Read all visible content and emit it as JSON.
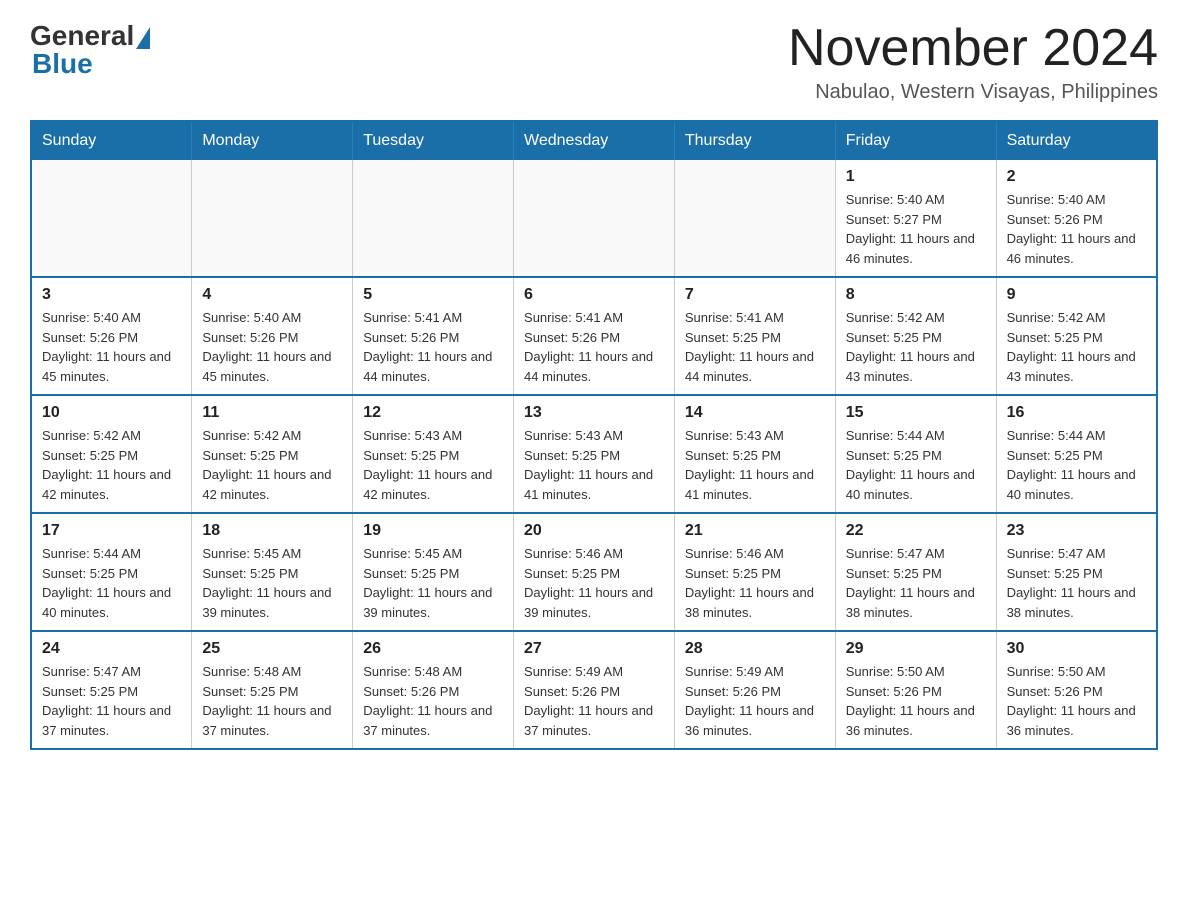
{
  "logo": {
    "general": "General",
    "blue": "Blue"
  },
  "title": "November 2024",
  "subtitle": "Nabulao, Western Visayas, Philippines",
  "headers": [
    "Sunday",
    "Monday",
    "Tuesday",
    "Wednesday",
    "Thursday",
    "Friday",
    "Saturday"
  ],
  "weeks": [
    [
      {
        "day": "",
        "info": ""
      },
      {
        "day": "",
        "info": ""
      },
      {
        "day": "",
        "info": ""
      },
      {
        "day": "",
        "info": ""
      },
      {
        "day": "",
        "info": ""
      },
      {
        "day": "1",
        "info": "Sunrise: 5:40 AM\nSunset: 5:27 PM\nDaylight: 11 hours and 46 minutes."
      },
      {
        "day": "2",
        "info": "Sunrise: 5:40 AM\nSunset: 5:26 PM\nDaylight: 11 hours and 46 minutes."
      }
    ],
    [
      {
        "day": "3",
        "info": "Sunrise: 5:40 AM\nSunset: 5:26 PM\nDaylight: 11 hours and 45 minutes."
      },
      {
        "day": "4",
        "info": "Sunrise: 5:40 AM\nSunset: 5:26 PM\nDaylight: 11 hours and 45 minutes."
      },
      {
        "day": "5",
        "info": "Sunrise: 5:41 AM\nSunset: 5:26 PM\nDaylight: 11 hours and 44 minutes."
      },
      {
        "day": "6",
        "info": "Sunrise: 5:41 AM\nSunset: 5:26 PM\nDaylight: 11 hours and 44 minutes."
      },
      {
        "day": "7",
        "info": "Sunrise: 5:41 AM\nSunset: 5:25 PM\nDaylight: 11 hours and 44 minutes."
      },
      {
        "day": "8",
        "info": "Sunrise: 5:42 AM\nSunset: 5:25 PM\nDaylight: 11 hours and 43 minutes."
      },
      {
        "day": "9",
        "info": "Sunrise: 5:42 AM\nSunset: 5:25 PM\nDaylight: 11 hours and 43 minutes."
      }
    ],
    [
      {
        "day": "10",
        "info": "Sunrise: 5:42 AM\nSunset: 5:25 PM\nDaylight: 11 hours and 42 minutes."
      },
      {
        "day": "11",
        "info": "Sunrise: 5:42 AM\nSunset: 5:25 PM\nDaylight: 11 hours and 42 minutes."
      },
      {
        "day": "12",
        "info": "Sunrise: 5:43 AM\nSunset: 5:25 PM\nDaylight: 11 hours and 42 minutes."
      },
      {
        "day": "13",
        "info": "Sunrise: 5:43 AM\nSunset: 5:25 PM\nDaylight: 11 hours and 41 minutes."
      },
      {
        "day": "14",
        "info": "Sunrise: 5:43 AM\nSunset: 5:25 PM\nDaylight: 11 hours and 41 minutes."
      },
      {
        "day": "15",
        "info": "Sunrise: 5:44 AM\nSunset: 5:25 PM\nDaylight: 11 hours and 40 minutes."
      },
      {
        "day": "16",
        "info": "Sunrise: 5:44 AM\nSunset: 5:25 PM\nDaylight: 11 hours and 40 minutes."
      }
    ],
    [
      {
        "day": "17",
        "info": "Sunrise: 5:44 AM\nSunset: 5:25 PM\nDaylight: 11 hours and 40 minutes."
      },
      {
        "day": "18",
        "info": "Sunrise: 5:45 AM\nSunset: 5:25 PM\nDaylight: 11 hours and 39 minutes."
      },
      {
        "day": "19",
        "info": "Sunrise: 5:45 AM\nSunset: 5:25 PM\nDaylight: 11 hours and 39 minutes."
      },
      {
        "day": "20",
        "info": "Sunrise: 5:46 AM\nSunset: 5:25 PM\nDaylight: 11 hours and 39 minutes."
      },
      {
        "day": "21",
        "info": "Sunrise: 5:46 AM\nSunset: 5:25 PM\nDaylight: 11 hours and 38 minutes."
      },
      {
        "day": "22",
        "info": "Sunrise: 5:47 AM\nSunset: 5:25 PM\nDaylight: 11 hours and 38 minutes."
      },
      {
        "day": "23",
        "info": "Sunrise: 5:47 AM\nSunset: 5:25 PM\nDaylight: 11 hours and 38 minutes."
      }
    ],
    [
      {
        "day": "24",
        "info": "Sunrise: 5:47 AM\nSunset: 5:25 PM\nDaylight: 11 hours and 37 minutes."
      },
      {
        "day": "25",
        "info": "Sunrise: 5:48 AM\nSunset: 5:25 PM\nDaylight: 11 hours and 37 minutes."
      },
      {
        "day": "26",
        "info": "Sunrise: 5:48 AM\nSunset: 5:26 PM\nDaylight: 11 hours and 37 minutes."
      },
      {
        "day": "27",
        "info": "Sunrise: 5:49 AM\nSunset: 5:26 PM\nDaylight: 11 hours and 37 minutes."
      },
      {
        "day": "28",
        "info": "Sunrise: 5:49 AM\nSunset: 5:26 PM\nDaylight: 11 hours and 36 minutes."
      },
      {
        "day": "29",
        "info": "Sunrise: 5:50 AM\nSunset: 5:26 PM\nDaylight: 11 hours and 36 minutes."
      },
      {
        "day": "30",
        "info": "Sunrise: 5:50 AM\nSunset: 5:26 PM\nDaylight: 11 hours and 36 minutes."
      }
    ]
  ]
}
